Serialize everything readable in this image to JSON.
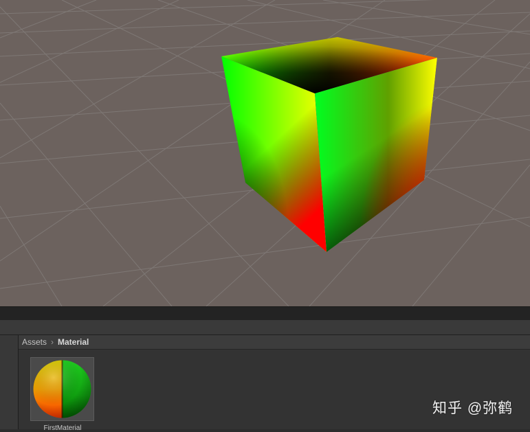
{
  "scene": {
    "background_color": "#6c625e",
    "grid_color": "#8e8a88",
    "object": "rgb-gradient-cube"
  },
  "breadcrumb": {
    "root": "Assets",
    "separator_icon": "chevron-right-icon",
    "current": "Material"
  },
  "assets": [
    {
      "name": "FirstMaterial",
      "preview": "material-sphere-preview"
    }
  ],
  "watermark": "知乎 @弥鹤"
}
